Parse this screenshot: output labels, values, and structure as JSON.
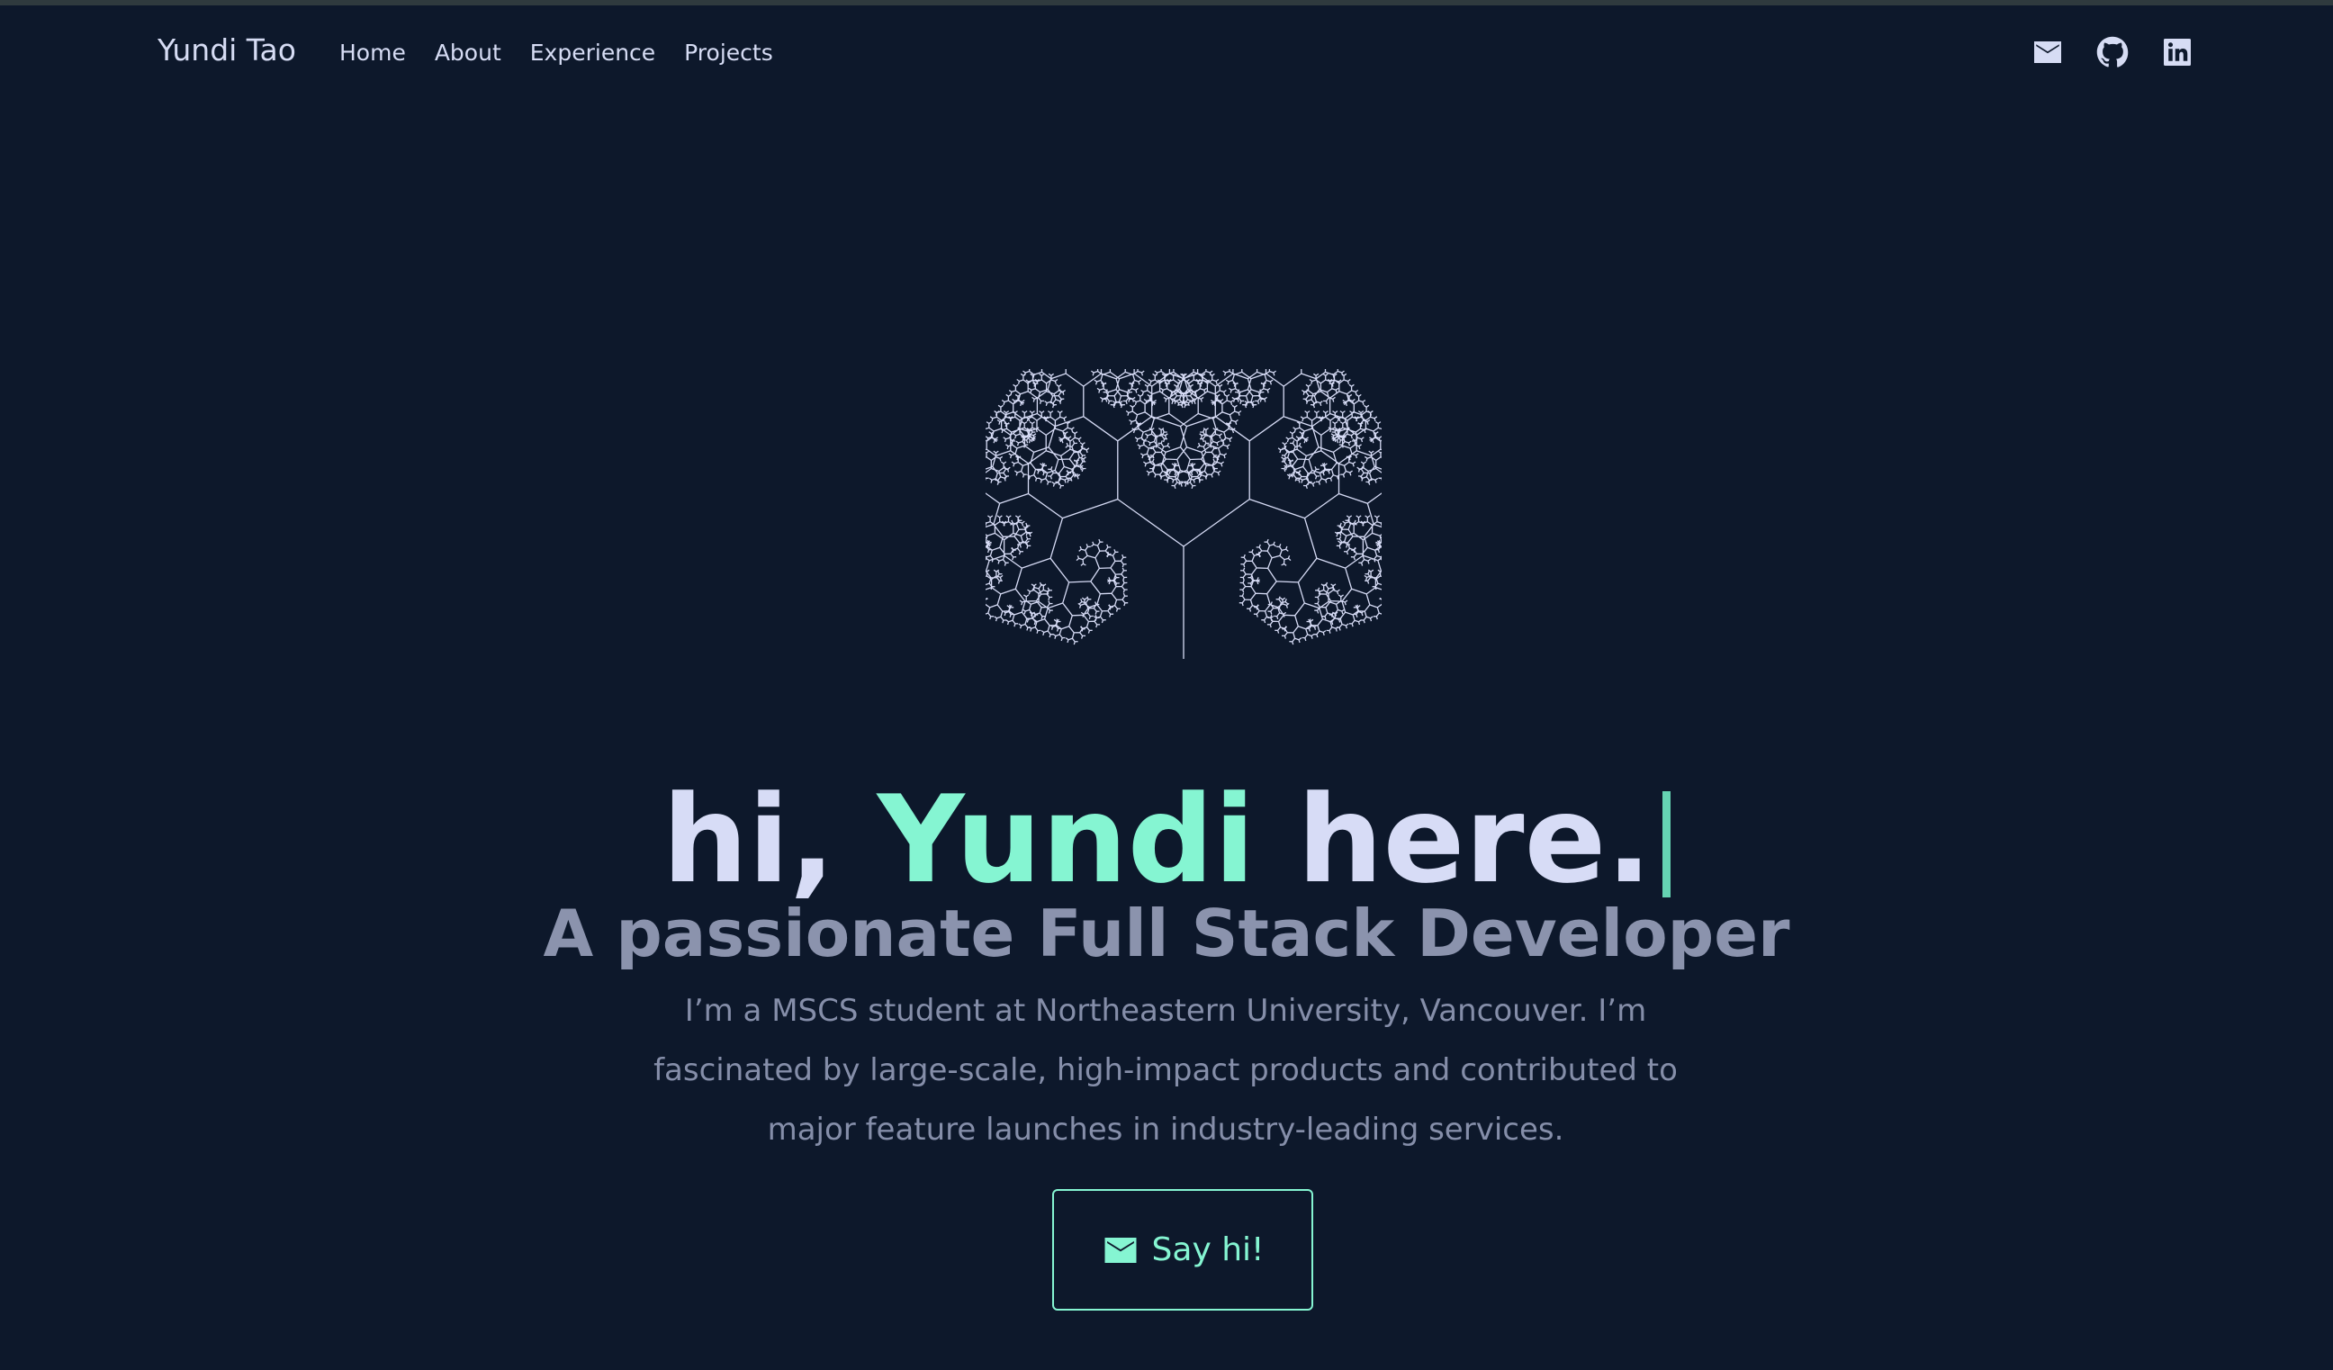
{
  "nav": {
    "brand": "Yundi Tao",
    "links": [
      {
        "label": "Home"
      },
      {
        "label": "About"
      },
      {
        "label": "Experience"
      },
      {
        "label": "Projects"
      }
    ],
    "social_icons": [
      "mail-icon",
      "github-icon",
      "linkedin-icon"
    ]
  },
  "hero": {
    "title_prefix": "hi,",
    "title_name": "Yundi",
    "title_suffix": "here.",
    "subtitle": "A passionate Full Stack Developer",
    "description": "I’m a MSCS student at Northeastern University, Vancouver. I’m fascinated by large-scale, high-impact products and contributed to major feature launches in industry-leading services.",
    "cta_label": "Say hi!",
    "cta_icon": "mail-icon"
  },
  "colors": {
    "background": "#0d182b",
    "accent": "#85f5d2",
    "text_primary": "#d7dcf6",
    "text_secondary": "#8b93ad"
  }
}
